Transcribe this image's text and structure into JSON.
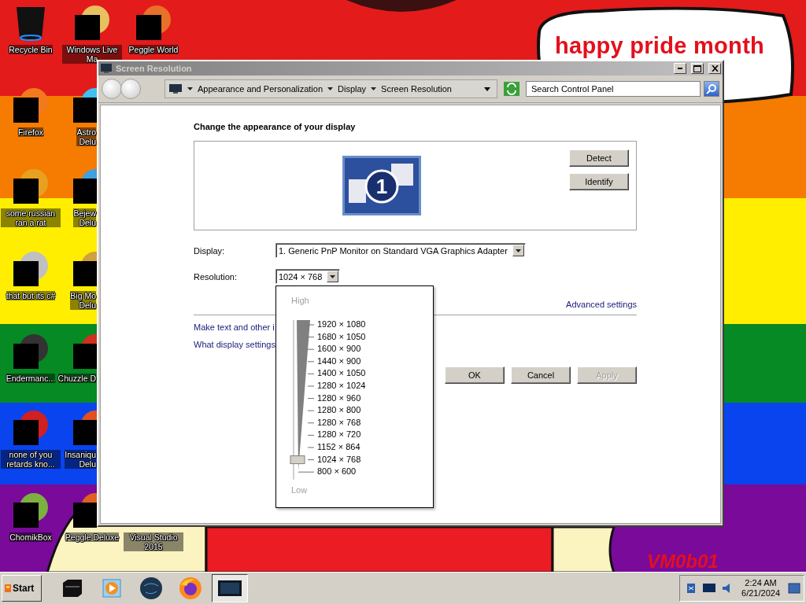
{
  "wallpaper": {
    "texts": [
      "happy pride month",
      "VM0b01"
    ]
  },
  "desktop_icons": [
    {
      "label": "Recycle Bin"
    },
    {
      "label": "Firefox"
    },
    {
      "label": "some russian ran a rat"
    },
    {
      "label": "that but its c#"
    },
    {
      "label": "Endermanc..."
    },
    {
      "label": "none of you retards kno..."
    },
    {
      "label": "ChomikBox"
    },
    {
      "label": "Windows Live Ma"
    },
    {
      "label": "Astro\nDelu"
    },
    {
      "label": "Bejew\nDelu"
    },
    {
      "label": "Big Mo\nDelu"
    },
    {
      "label": "Chuzzle D"
    },
    {
      "label": "Insaniqu\nDelu"
    },
    {
      "label": "Peggle Deluxe"
    },
    {
      "label": "Peggle World"
    },
    {
      "label": "Visual Studio 2015"
    }
  ],
  "window": {
    "title": "Screen Resolution"
  },
  "address_bar": {
    "breadcrumb": [
      "Appearance and Personalization",
      "Display",
      "Screen Resolution"
    ]
  },
  "search": {
    "placeholder": "Search Control Panel"
  },
  "heading": "Change the appearance of your display",
  "monitor": {
    "number": "1"
  },
  "preview_buttons": [
    "Detect",
    "Identify"
  ],
  "fields": [
    {
      "label": "Display:",
      "value": "1. Generic PnP Monitor on Standard VGA Graphics Adapter"
    },
    {
      "label": "Resolution:",
      "value": "1024 × 768"
    }
  ],
  "advanced_link": "Advanced settings",
  "links": [
    "Make text and other i",
    "What display settings"
  ],
  "dialog_buttons": [
    {
      "label": "OK",
      "disabled": false
    },
    {
      "label": "Cancel",
      "disabled": false
    },
    {
      "label": "Apply",
      "disabled": true
    }
  ],
  "resolution_menu": {
    "high": "High",
    "low": "Low",
    "options": [
      {
        "label": "1920 × 1080",
        "selected": false
      },
      {
        "label": "1680 × 1050",
        "selected": false
      },
      {
        "label": "1600 × 900",
        "selected": false
      },
      {
        "label": "1440 × 900",
        "selected": false
      },
      {
        "label": "1400 × 1050",
        "selected": false
      },
      {
        "label": "1280 × 1024",
        "selected": false
      },
      {
        "label": "1280 × 960",
        "selected": false
      },
      {
        "label": "1280 × 800",
        "selected": false
      },
      {
        "label": "1280 × 768",
        "selected": false
      },
      {
        "label": "1280 × 720",
        "selected": false
      },
      {
        "label": "1152 × 864",
        "selected": false
      },
      {
        "label": "1024 × 768",
        "selected": true
      },
      {
        "label": "800 × 600",
        "selected": false
      }
    ]
  },
  "taskbar": {
    "start": "Start",
    "apps": [
      {
        "selected": false
      },
      {
        "selected": false
      },
      {
        "selected": false
      },
      {
        "selected": false
      },
      {
        "selected": true
      }
    ],
    "time": "2:24 AM",
    "date": "6/21/2024"
  }
}
